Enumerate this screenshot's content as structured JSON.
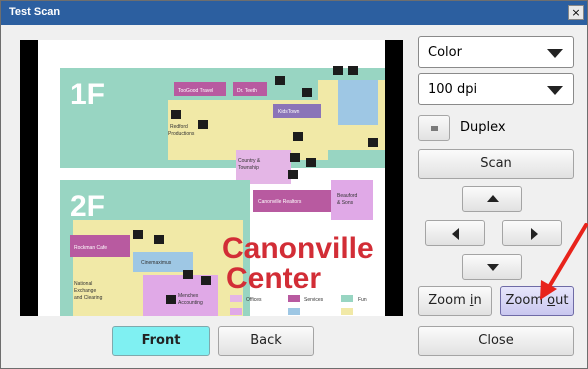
{
  "window": {
    "title": "Test Scan",
    "close_glyph": "×"
  },
  "preview": {
    "floor1": "1F",
    "floor2": "2F",
    "heading_line1": "Canonville",
    "heading_line2": "Center",
    "stores": {
      "toogood": "TooGood Travel",
      "drteeth": "Dr. Teeth",
      "kidstown": "KidsTown",
      "redford1": "Redford",
      "redford2": "Productions",
      "country1": "Country &",
      "country2": "Township",
      "canonville_realtors": "Canonville Realtors",
      "beauford1": "Beauford",
      "beauford2": "& Sons",
      "rockman": "Rockman Cafe",
      "cinemaximus": "Cinemaximus",
      "national1": "National",
      "national2": "Exchange",
      "national3": "and Clearing",
      "menchex1": "Menchex",
      "menchex2": "Accounting"
    },
    "legend": {
      "offices": "Offices",
      "services": "Services",
      "fun": "Fun"
    }
  },
  "controls": {
    "color_mode": "Color",
    "resolution": "100 dpi",
    "duplex_label": "Duplex",
    "scan_label": "Scan",
    "zoom_in_pre": "Zoom ",
    "zoom_in_key": "i",
    "zoom_in_post": "n",
    "zoom_out_pre": "Zoom ",
    "zoom_out_key": "o",
    "zoom_out_post": "ut",
    "front_label": "Front",
    "back_label": "Back",
    "close_label": "Close"
  },
  "colors": {
    "titlebar": "#2c5fa0",
    "front_active": "#7ff0f2",
    "zoom_out_hover": "#c9c7ef",
    "annotation_arrow": "#e8231b"
  },
  "icons": [
    "close-icon",
    "dropdown-arrow-icon",
    "arrow-up-icon",
    "arrow-left-icon",
    "arrow-right-icon",
    "arrow-down-icon",
    "annotation-arrow-icon"
  ]
}
